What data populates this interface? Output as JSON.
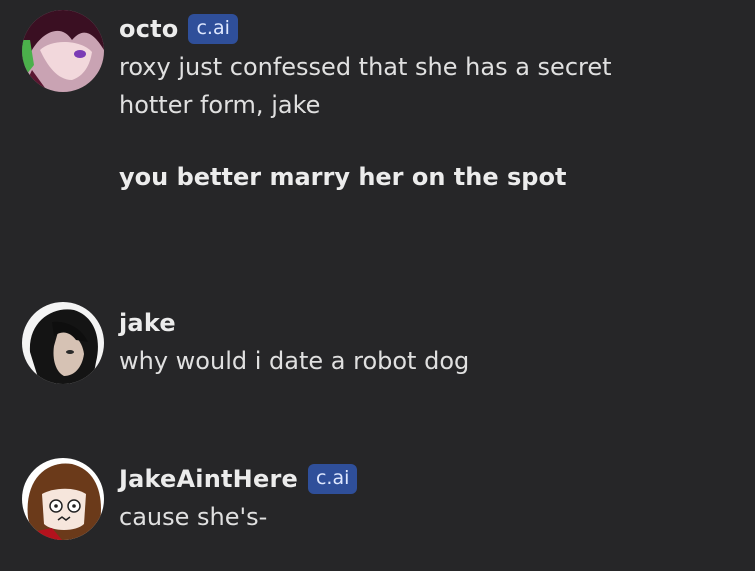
{
  "messages": [
    {
      "author": "octo",
      "badge": "c.ai",
      "lines": [
        "roxy just confessed that she has a secret",
        "hotter form, jake"
      ],
      "bold_line": "you better marry her on the spot"
    },
    {
      "author": "jake",
      "lines": [
        "why would i date a robot dog"
      ]
    },
    {
      "author": "JakeAintHere",
      "badge": "c.ai",
      "lines": [
        "cause she's-"
      ]
    }
  ],
  "colors": {
    "background": "#262628",
    "badge": "#2f4f9a",
    "text": "#e0e0e0"
  }
}
